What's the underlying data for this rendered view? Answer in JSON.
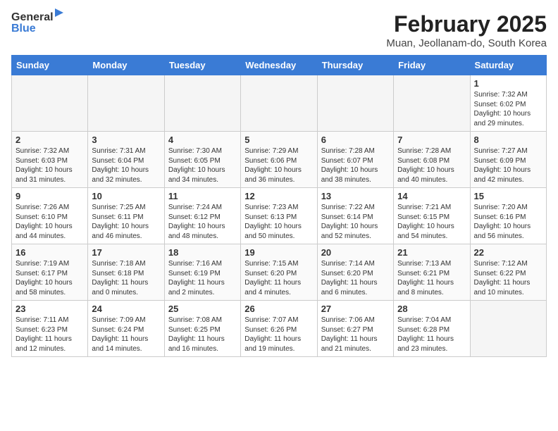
{
  "header": {
    "logo_line1": "General",
    "logo_line2": "Blue",
    "main_title": "February 2025",
    "subtitle": "Muan, Jeollanam-do, South Korea"
  },
  "calendar": {
    "days_of_week": [
      "Sunday",
      "Monday",
      "Tuesday",
      "Wednesday",
      "Thursday",
      "Friday",
      "Saturday"
    ],
    "weeks": [
      [
        {
          "day": "",
          "info": ""
        },
        {
          "day": "",
          "info": ""
        },
        {
          "day": "",
          "info": ""
        },
        {
          "day": "",
          "info": ""
        },
        {
          "day": "",
          "info": ""
        },
        {
          "day": "",
          "info": ""
        },
        {
          "day": "1",
          "info": "Sunrise: 7:32 AM\nSunset: 6:02 PM\nDaylight: 10 hours and 29 minutes."
        }
      ],
      [
        {
          "day": "2",
          "info": "Sunrise: 7:32 AM\nSunset: 6:03 PM\nDaylight: 10 hours and 31 minutes."
        },
        {
          "day": "3",
          "info": "Sunrise: 7:31 AM\nSunset: 6:04 PM\nDaylight: 10 hours and 32 minutes."
        },
        {
          "day": "4",
          "info": "Sunrise: 7:30 AM\nSunset: 6:05 PM\nDaylight: 10 hours and 34 minutes."
        },
        {
          "day": "5",
          "info": "Sunrise: 7:29 AM\nSunset: 6:06 PM\nDaylight: 10 hours and 36 minutes."
        },
        {
          "day": "6",
          "info": "Sunrise: 7:28 AM\nSunset: 6:07 PM\nDaylight: 10 hours and 38 minutes."
        },
        {
          "day": "7",
          "info": "Sunrise: 7:28 AM\nSunset: 6:08 PM\nDaylight: 10 hours and 40 minutes."
        },
        {
          "day": "8",
          "info": "Sunrise: 7:27 AM\nSunset: 6:09 PM\nDaylight: 10 hours and 42 minutes."
        }
      ],
      [
        {
          "day": "9",
          "info": "Sunrise: 7:26 AM\nSunset: 6:10 PM\nDaylight: 10 hours and 44 minutes."
        },
        {
          "day": "10",
          "info": "Sunrise: 7:25 AM\nSunset: 6:11 PM\nDaylight: 10 hours and 46 minutes."
        },
        {
          "day": "11",
          "info": "Sunrise: 7:24 AM\nSunset: 6:12 PM\nDaylight: 10 hours and 48 minutes."
        },
        {
          "day": "12",
          "info": "Sunrise: 7:23 AM\nSunset: 6:13 PM\nDaylight: 10 hours and 50 minutes."
        },
        {
          "day": "13",
          "info": "Sunrise: 7:22 AM\nSunset: 6:14 PM\nDaylight: 10 hours and 52 minutes."
        },
        {
          "day": "14",
          "info": "Sunrise: 7:21 AM\nSunset: 6:15 PM\nDaylight: 10 hours and 54 minutes."
        },
        {
          "day": "15",
          "info": "Sunrise: 7:20 AM\nSunset: 6:16 PM\nDaylight: 10 hours and 56 minutes."
        }
      ],
      [
        {
          "day": "16",
          "info": "Sunrise: 7:19 AM\nSunset: 6:17 PM\nDaylight: 10 hours and 58 minutes."
        },
        {
          "day": "17",
          "info": "Sunrise: 7:18 AM\nSunset: 6:18 PM\nDaylight: 11 hours and 0 minutes."
        },
        {
          "day": "18",
          "info": "Sunrise: 7:16 AM\nSunset: 6:19 PM\nDaylight: 11 hours and 2 minutes."
        },
        {
          "day": "19",
          "info": "Sunrise: 7:15 AM\nSunset: 6:20 PM\nDaylight: 11 hours and 4 minutes."
        },
        {
          "day": "20",
          "info": "Sunrise: 7:14 AM\nSunset: 6:20 PM\nDaylight: 11 hours and 6 minutes."
        },
        {
          "day": "21",
          "info": "Sunrise: 7:13 AM\nSunset: 6:21 PM\nDaylight: 11 hours and 8 minutes."
        },
        {
          "day": "22",
          "info": "Sunrise: 7:12 AM\nSunset: 6:22 PM\nDaylight: 11 hours and 10 minutes."
        }
      ],
      [
        {
          "day": "23",
          "info": "Sunrise: 7:11 AM\nSunset: 6:23 PM\nDaylight: 11 hours and 12 minutes."
        },
        {
          "day": "24",
          "info": "Sunrise: 7:09 AM\nSunset: 6:24 PM\nDaylight: 11 hours and 14 minutes."
        },
        {
          "day": "25",
          "info": "Sunrise: 7:08 AM\nSunset: 6:25 PM\nDaylight: 11 hours and 16 minutes."
        },
        {
          "day": "26",
          "info": "Sunrise: 7:07 AM\nSunset: 6:26 PM\nDaylight: 11 hours and 19 minutes."
        },
        {
          "day": "27",
          "info": "Sunrise: 7:06 AM\nSunset: 6:27 PM\nDaylight: 11 hours and 21 minutes."
        },
        {
          "day": "28",
          "info": "Sunrise: 7:04 AM\nSunset: 6:28 PM\nDaylight: 11 hours and 23 minutes."
        },
        {
          "day": "",
          "info": ""
        }
      ]
    ]
  }
}
